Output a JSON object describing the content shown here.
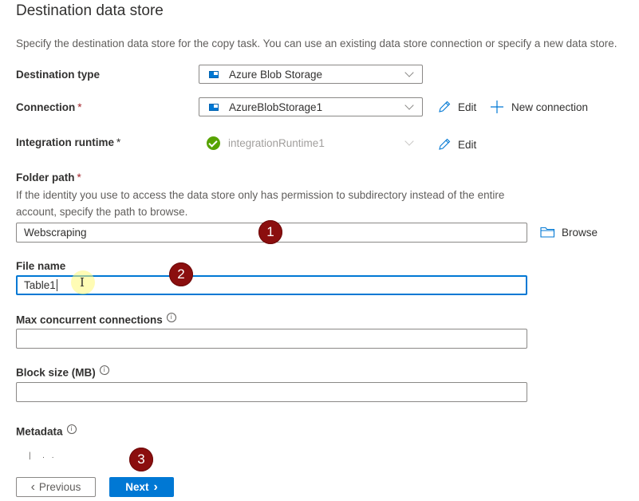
{
  "page": {
    "title": "Destination data store",
    "description": "Specify the destination data store for the copy task. You can use an existing data store connection or specify a new data store."
  },
  "fields": {
    "destination_type": {
      "label": "Destination type",
      "value": "Azure Blob Storage",
      "icon": "blob-storage-icon"
    },
    "connection": {
      "label": "Connection",
      "required_mark": "*",
      "value": "AzureBlobStorage1",
      "icon": "blob-storage-icon",
      "edit_label": "Edit",
      "new_connection_label": "New connection"
    },
    "integration_runtime": {
      "label": "Integration runtime",
      "required_mark": "*",
      "value": "integrationRuntime1",
      "icon": "check-circle-icon",
      "edit_label": "Edit"
    },
    "folder_path": {
      "label": "Folder path",
      "required_mark": "*",
      "help_line1": "If the identity you use to access the data store only has permission to subdirectory instead of the entire",
      "help_line2": "account, specify the path to browse.",
      "value": "Webscraping",
      "browse_label": "Browse"
    },
    "file_name": {
      "label": "File name",
      "value": "Table1"
    },
    "max_concurrent_connections": {
      "label": "Max concurrent connections",
      "value": ""
    },
    "block_size": {
      "label": "Block size (MB)",
      "value": ""
    },
    "metadata": {
      "label": "Metadata"
    }
  },
  "annotations": [
    "1",
    "2",
    "3"
  ],
  "footer": {
    "previous_label": "Previous",
    "previous_icon": "‹",
    "next_label": "Next",
    "next_icon": "›"
  },
  "colors": {
    "primary": "#0078d4",
    "badge": "#8b0e0e",
    "success": "#57a300",
    "required": "#a4262c"
  }
}
